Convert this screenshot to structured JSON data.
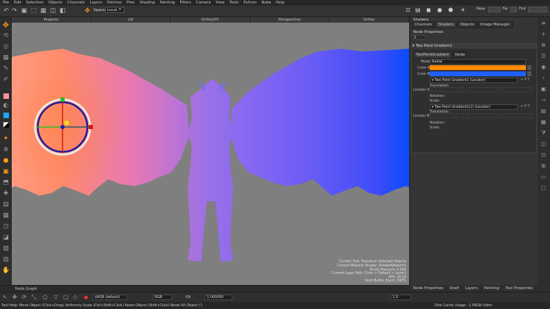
{
  "menu": [
    "File",
    "Edit",
    "Selection",
    "Objects",
    "Channels",
    "Layers",
    "Patches",
    "Ptex",
    "Shading",
    "Painting",
    "Filters",
    "Camera",
    "View",
    "Tools",
    "Python",
    "Nuke",
    "Help"
  ],
  "toolbar": {
    "space_label": "Space",
    "space_value": "Local",
    "near_label": "Near",
    "far_label": "Far",
    "fov_label": "FoV"
  },
  "viewport_tabs": [
    "Projects",
    "UV",
    "Ortho/UV",
    "Perspective",
    "Ortho"
  ],
  "hud_lines": [
    "Current Tool: Transform Selected Objects",
    "Current Modular Shader: ShaderNetwork1",
    "Brush Pressure: 0.000",
    "Current Layer Path: Color > Default > Layer1",
    "FPS: 30.00",
    "Paint Buffer Zoom: 100%"
  ],
  "panel": {
    "header": "Shaders",
    "tabs": [
      "Channels",
      "Shaders",
      "Objects",
      "Image Manager"
    ],
    "node_properties": "Node Properties",
    "node_number": "2",
    "section_title": "Two Point Gradient1",
    "subtabs": [
      "TwoPointGradient",
      "Node"
    ],
    "mode_label": "Mode",
    "mode_value": "Radial",
    "color_a_label": "Color A",
    "color_b_label": "Color B",
    "color_a": "#ff8c00",
    "color_b": "#1f5fff",
    "locator_a_label": "Locator A",
    "locator_a_value": "Two Point Gradient1 (Locator)",
    "locator_b_label": "Locator B",
    "locator_b_value": "Two Point Gradient1(2) (Locator)",
    "translation_label": "Translation:",
    "rotation_label": "Rotation:",
    "scale_label": "Scale:"
  },
  "bottom_tabs": [
    "Node Properties",
    "Shelf",
    "Layers",
    "Painting",
    "Tool Properties"
  ],
  "node_graph_label": "Node Graph",
  "status": {
    "colorspace": "sRGB (default)",
    "channels": "RGB",
    "ratio": "f/8",
    "exposure": "1.000000",
    "gamma": "1.0",
    "disk_cache": "Disk Cache Usage : 1.56GB Udim:"
  },
  "help_text": "Tool Help: Move Object (Click+Drag)  Uniformly Scale (Ctrl+Shift+Click)  Reset Object (Shift+Click)  Reset All Object (')"
}
